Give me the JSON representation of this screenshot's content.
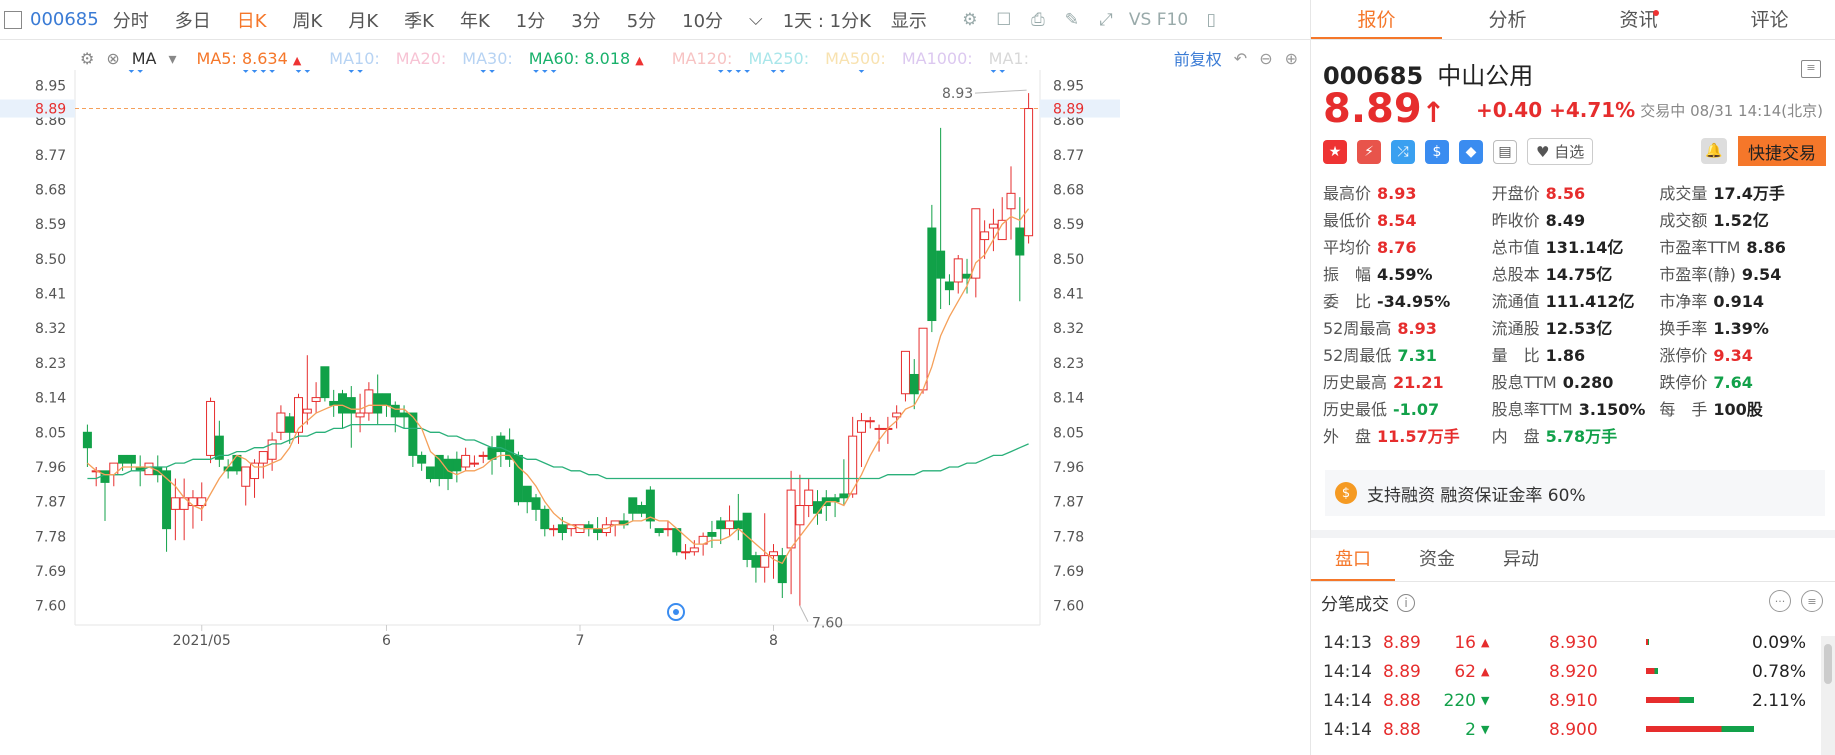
{
  "toolbar": {
    "code": "000685",
    "periods": [
      "分时",
      "多日",
      "日K",
      "周K",
      "月K",
      "季K",
      "年K",
      "1分",
      "3分",
      "5分",
      "10分"
    ],
    "active_period": "日K",
    "interval_select": "1天 : 1分K",
    "display_label": "显示",
    "vs_label": "VS F10"
  },
  "ma_bar": {
    "selector": "MA",
    "items": [
      {
        "label": "MA5:",
        "value": "8.634",
        "arrow": "▲",
        "color": "#f5772a"
      },
      {
        "label": "MA10:",
        "value": "",
        "color": "#b7d3f3"
      },
      {
        "label": "MA20:",
        "value": "",
        "color": "#f7c3d4"
      },
      {
        "label": "MA30:",
        "value": "",
        "color": "#b7d3f3"
      },
      {
        "label": "MA60:",
        "value": "8.018",
        "arrow": "▲",
        "color": "#19b16b"
      },
      {
        "label": "MA120:",
        "value": "",
        "color": "#f7c3c3"
      },
      {
        "label": "MA250:",
        "value": "",
        "color": "#a9e6ea"
      },
      {
        "label": "MA500:",
        "value": "",
        "color": "#f8e2b0"
      },
      {
        "label": "MA1000:",
        "value": "",
        "color": "#dcc8f0"
      },
      {
        "label": "MA1:",
        "value": "",
        "color": "#d8d8d8"
      }
    ],
    "adjust_label": "前复权"
  },
  "chart_data": {
    "type": "candlestick",
    "y_ticks": [
      "8.95",
      "8.86",
      "8.77",
      "8.68",
      "8.59",
      "8.50",
      "8.41",
      "8.32",
      "8.23",
      "8.14",
      "8.05",
      "7.96",
      "7.87",
      "7.78",
      "7.69",
      "7.60"
    ],
    "ylim": [
      7.55,
      8.99
    ],
    "x_labels": [
      "2021/05",
      "6",
      "7",
      "8"
    ],
    "x_label_positions": [
      13,
      34,
      56,
      78
    ],
    "current_price_line": "8.89",
    "annotation_high": "8.93",
    "annotation_low": "7.60",
    "candles": [
      [
        8.05,
        8.01,
        8.07,
        7.96
      ],
      [
        7.95,
        7.95,
        7.96,
        7.91
      ],
      [
        7.95,
        7.92,
        7.92,
        7.82
      ],
      [
        7.94,
        7.97,
        7.97,
        7.91
      ],
      [
        7.99,
        7.97,
        7.99,
        7.95
      ],
      [
        7.99,
        7.97,
        7.99,
        7.95
      ],
      [
        7.96,
        7.95,
        7.99,
        7.91
      ],
      [
        7.94,
        7.97,
        7.97,
        7.94
      ],
      [
        7.96,
        7.94,
        7.99,
        7.92
      ],
      [
        7.95,
        7.8,
        7.96,
        7.74
      ],
      [
        7.85,
        7.88,
        7.93,
        7.77
      ],
      [
        7.85,
        7.88,
        7.93,
        7.77
      ],
      [
        7.86,
        7.88,
        7.9,
        7.8
      ],
      [
        7.86,
        7.88,
        7.92,
        7.82
      ],
      [
        7.99,
        8.13,
        8.14,
        7.97
      ],
      [
        8.04,
        7.98,
        8.08,
        7.96
      ],
      [
        7.96,
        7.95,
        7.98,
        7.93
      ],
      [
        7.99,
        7.95,
        7.98,
        7.94
      ],
      [
        7.91,
        7.96,
        7.96,
        7.86
      ],
      [
        7.93,
        7.97,
        7.98,
        7.88
      ],
      [
        7.97,
        8.0,
        8.0,
        7.93
      ],
      [
        7.98,
        8.03,
        8.05,
        7.95
      ],
      [
        8.05,
        8.1,
        8.12,
        8.03
      ],
      [
        8.09,
        8.05,
        8.1,
        8.02
      ],
      [
        8.05,
        8.14,
        8.15,
        8.02
      ],
      [
        8.1,
        8.11,
        8.25,
        8.07
      ],
      [
        8.13,
        8.14,
        8.18,
        8.1
      ],
      [
        8.22,
        8.14,
        8.22,
        8.13
      ],
      [
        8.13,
        8.12,
        8.16,
        8.09
      ],
      [
        8.15,
        8.1,
        8.16,
        8.06
      ],
      [
        8.14,
        8.1,
        8.17,
        8.01
      ],
      [
        8.09,
        8.1,
        8.15,
        8.05
      ],
      [
        8.1,
        8.16,
        8.18,
        8.08
      ],
      [
        8.15,
        8.1,
        8.2,
        8.07
      ],
      [
        8.15,
        8.12,
        8.15,
        8.09
      ],
      [
        8.12,
        8.09,
        8.13,
        8.05
      ],
      [
        8.1,
        8.09,
        8.12,
        8.06
      ],
      [
        8.1,
        7.99,
        8.1,
        7.96
      ],
      [
        7.99,
        7.97,
        8.0,
        7.95
      ],
      [
        7.96,
        7.93,
        7.96,
        7.92
      ],
      [
        7.99,
        7.93,
        7.98,
        7.91
      ],
      [
        7.98,
        7.93,
        7.99,
        7.9
      ],
      [
        7.98,
        7.95,
        8.0,
        7.92
      ],
      [
        7.96,
        7.99,
        8.01,
        7.95
      ],
      [
        7.97,
        7.97,
        7.99,
        7.96
      ],
      [
        7.99,
        7.99,
        8.0,
        7.97
      ],
      [
        8.01,
        7.98,
        8.04,
        7.94
      ],
      [
        8.04,
        8.0,
        8.05,
        7.96
      ],
      [
        8.03,
        7.98,
        8.06,
        7.96
      ],
      [
        7.99,
        7.87,
        8.0,
        7.86
      ],
      [
        7.91,
        7.87,
        7.91,
        7.84
      ],
      [
        7.88,
        7.85,
        7.89,
        7.82
      ],
      [
        7.85,
        7.8,
        7.86,
        7.78
      ],
      [
        7.8,
        7.8,
        7.81,
        7.78
      ],
      [
        7.81,
        7.79,
        7.83,
        7.77
      ],
      [
        7.8,
        7.81,
        7.81,
        7.78
      ],
      [
        7.79,
        7.81,
        7.81,
        7.79
      ],
      [
        7.81,
        7.8,
        7.82,
        7.78
      ],
      [
        7.8,
        7.79,
        7.83,
        7.77
      ],
      [
        7.79,
        7.81,
        7.83,
        7.78
      ],
      [
        7.81,
        7.82,
        7.82,
        7.78
      ],
      [
        7.82,
        7.81,
        7.84,
        7.8
      ],
      [
        7.88,
        7.84,
        7.88,
        7.82
      ],
      [
        7.86,
        7.84,
        7.87,
        7.83
      ],
      [
        7.9,
        7.82,
        7.91,
        7.8
      ],
      [
        7.8,
        7.79,
        7.8,
        7.78
      ],
      [
        7.8,
        7.8,
        7.82,
        7.78
      ],
      [
        7.8,
        7.74,
        7.8,
        7.73
      ],
      [
        7.74,
        7.74,
        7.76,
        7.72
      ],
      [
        7.74,
        7.75,
        7.77,
        7.73
      ],
      [
        7.76,
        7.78,
        7.79,
        7.73
      ],
      [
        7.79,
        7.78,
        7.82,
        7.75
      ],
      [
        7.82,
        7.8,
        7.83,
        7.76
      ],
      [
        7.8,
        7.82,
        7.86,
        7.78
      ],
      [
        7.82,
        7.8,
        7.89,
        7.77
      ],
      [
        7.84,
        7.72,
        7.84,
        7.7
      ],
      [
        7.73,
        7.7,
        7.74,
        7.66
      ],
      [
        7.7,
        7.73,
        7.84,
        7.66
      ],
      [
        7.73,
        7.74,
        7.76,
        7.67
      ],
      [
        7.73,
        7.66,
        7.75,
        7.62
      ],
      [
        7.75,
        7.9,
        7.95,
        7.63
      ],
      [
        7.81,
        7.86,
        7.94,
        7.6
      ],
      [
        7.86,
        7.9,
        7.93,
        7.83
      ],
      [
        7.87,
        7.84,
        7.9,
        7.81
      ],
      [
        7.88,
        7.86,
        7.9,
        7.82
      ],
      [
        7.88,
        7.87,
        7.89,
        7.83
      ],
      [
        7.89,
        7.88,
        7.98,
        7.86
      ],
      [
        7.89,
        8.04,
        8.09,
        7.88
      ],
      [
        8.05,
        8.08,
        8.1,
        7.96
      ],
      [
        8.08,
        8.08,
        8.09,
        8.06
      ],
      [
        8.06,
        8.06,
        8.07,
        8.0
      ],
      [
        8.06,
        8.06,
        8.09,
        8.02
      ],
      [
        8.09,
        8.1,
        8.12,
        8.06
      ],
      [
        8.15,
        8.26,
        8.26,
        8.13
      ],
      [
        8.2,
        8.15,
        8.24,
        8.11
      ],
      [
        8.16,
        8.32,
        8.32,
        8.15
      ],
      [
        8.58,
        8.34,
        8.64,
        8.31
      ],
      [
        8.52,
        8.45,
        8.84,
        8.37
      ],
      [
        8.44,
        8.42,
        8.46,
        8.38
      ],
      [
        8.44,
        8.5,
        8.51,
        8.41
      ],
      [
        8.46,
        8.45,
        8.5,
        8.41
      ],
      [
        8.45,
        8.63,
        8.63,
        8.4
      ],
      [
        8.55,
        8.57,
        8.6,
        8.5
      ],
      [
        8.58,
        8.59,
        8.63,
        8.52
      ],
      [
        8.55,
        8.6,
        8.66,
        8.55
      ],
      [
        8.63,
        8.67,
        8.74,
        8.55
      ],
      [
        8.58,
        8.51,
        8.66,
        8.39
      ],
      [
        8.56,
        8.89,
        8.93,
        8.54
      ]
    ],
    "ma5": [
      7.97,
      7.95,
      7.94,
      7.94,
      7.96,
      7.96,
      7.96,
      7.96,
      7.95,
      7.93,
      7.91,
      7.88,
      7.86,
      7.85,
      7.89,
      7.93,
      7.96,
      7.99,
      7.98,
      7.96,
      7.96,
      7.97,
      7.98,
      8.01,
      8.06,
      8.08,
      8.1,
      8.11,
      8.12,
      8.12,
      8.11,
      8.11,
      8.12,
      8.12,
      8.12,
      8.11,
      8.11,
      8.09,
      8.06,
      8.0,
      7.98,
      7.95,
      7.94,
      7.95,
      7.95,
      7.96,
      7.98,
      7.99,
      7.99,
      7.96,
      7.94,
      7.91,
      7.87,
      7.84,
      7.82,
      7.81,
      7.8,
      7.8,
      7.8,
      7.8,
      7.81,
      7.81,
      7.82,
      7.82,
      7.83,
      7.82,
      7.82,
      7.8,
      7.78,
      7.76,
      7.76,
      7.77,
      7.77,
      7.78,
      7.8,
      7.78,
      7.76,
      7.74,
      7.72,
      7.71,
      7.75,
      7.78,
      7.81,
      7.84,
      7.87,
      7.87,
      7.86,
      7.9,
      7.94,
      7.99,
      8.03,
      8.06,
      8.08,
      8.11,
      8.12,
      8.16,
      8.22,
      8.3,
      8.35,
      8.39,
      8.43,
      8.49,
      8.51,
      8.55,
      8.59,
      8.61,
      8.6,
      8.63
    ],
    "ma60": [
      7.93,
      7.93,
      7.94,
      7.94,
      7.94,
      7.95,
      7.95,
      7.96,
      7.96,
      7.96,
      7.97,
      7.97,
      7.98,
      7.98,
      7.98,
      7.99,
      7.99,
      8.0,
      8.0,
      8.01,
      8.01,
      8.02,
      8.02,
      8.03,
      8.04,
      8.04,
      8.05,
      8.05,
      8.06,
      8.06,
      8.07,
      8.07,
      8.07,
      8.07,
      8.07,
      8.07,
      8.06,
      8.06,
      8.06,
      8.05,
      8.05,
      8.04,
      8.04,
      8.03,
      8.03,
      8.02,
      8.01,
      8.01,
      8.0,
      7.99,
      7.98,
      7.98,
      7.97,
      7.96,
      7.96,
      7.95,
      7.95,
      7.94,
      7.94,
      7.93,
      7.93,
      7.93,
      7.93,
      7.93,
      7.93,
      7.93,
      7.93,
      7.93,
      7.93,
      7.93,
      7.93,
      7.93,
      7.93,
      7.93,
      7.93,
      7.93,
      7.93,
      7.93,
      7.93,
      7.93,
      7.93,
      7.93,
      7.93,
      7.93,
      7.93,
      7.93,
      7.93,
      7.93,
      7.93,
      7.93,
      7.93,
      7.94,
      7.94,
      7.94,
      7.94,
      7.95,
      7.95,
      7.95,
      7.96,
      7.96,
      7.97,
      7.97,
      7.98,
      7.99,
      7.99,
      8.0,
      8.01,
      8.02
    ]
  },
  "quote": {
    "code": "000685",
    "name": "中山公用",
    "price": "8.89",
    "arrow": "↑",
    "change": "+0.40",
    "change_pct": "+4.71%",
    "status": "交易中 08/31 14:14(北京)",
    "watch_label": "自选",
    "quick_trade": "快捷交易",
    "stats": [
      [
        [
          "最高价",
          "8.93",
          "red"
        ],
        [
          "开盘价",
          "8.56",
          "red"
        ],
        [
          "成交量",
          "17.4万手",
          "blk"
        ]
      ],
      [
        [
          "最低价",
          "8.54",
          "red"
        ],
        [
          "昨收价",
          "8.49",
          "blk"
        ],
        [
          "成交额",
          "1.52亿",
          "blk"
        ]
      ],
      [
        [
          "平均价",
          "8.76",
          "red"
        ],
        [
          "总市值",
          "131.14亿",
          "blk"
        ],
        [
          "市盈率TTM",
          "8.86",
          "blk"
        ]
      ],
      [
        [
          "振　幅",
          "4.59%",
          "blk"
        ],
        [
          "总股本",
          "14.75亿",
          "blk"
        ],
        [
          "市盈率(静)",
          "9.54",
          "blk"
        ]
      ],
      [
        [
          "委　比",
          "-34.95%",
          "blk"
        ],
        [
          "流通值",
          "111.412亿",
          "blk"
        ],
        [
          "市净率",
          "0.914",
          "blk"
        ]
      ],
      [
        [
          "52周最高",
          "8.93",
          "red"
        ],
        [
          "流通股",
          "12.53亿",
          "blk"
        ],
        [
          "换手率",
          "1.39%",
          "blk"
        ]
      ],
      [
        [
          "52周最低",
          "7.31",
          "grn"
        ],
        [
          "量　比",
          "1.86",
          "blk"
        ],
        [
          "涨停价",
          "9.34",
          "red"
        ]
      ],
      [
        [
          "历史最高",
          "21.21",
          "red"
        ],
        [
          "股息TTM",
          "0.280",
          "blk"
        ],
        [
          "跌停价",
          "7.64",
          "grn"
        ]
      ],
      [
        [
          "历史最低",
          "-1.07",
          "grn"
        ],
        [
          "股息率TTM",
          "3.150%",
          "blk"
        ],
        [
          "每　手",
          "100股",
          "blk"
        ]
      ],
      [
        [
          "外　盘",
          "11.57万手",
          "red"
        ],
        [
          "内　盘",
          "5.78万手",
          "grn"
        ],
        [
          "",
          "",
          " "
        ]
      ]
    ],
    "margin_text": "支持融资 融资保证金率 60%"
  },
  "right_tabs": [
    "报价",
    "分析",
    "资讯",
    "评论"
  ],
  "sub_tabs": [
    "盘口",
    "资金",
    "异动"
  ],
  "fenbi": {
    "title": "分笔成交",
    "rows": [
      {
        "time": "14:13",
        "price": "8.89",
        "vol": "16",
        "dir": "up",
        "level": "8.930",
        "pct": "0.09%",
        "bar": 0.02
      },
      {
        "time": "14:14",
        "price": "8.89",
        "vol": "62",
        "dir": "up",
        "level": "8.920",
        "pct": "0.78%",
        "bar": 0.1
      },
      {
        "time": "14:14",
        "price": "8.88",
        "vol": "220",
        "dir": "down",
        "level": "8.910",
        "pct": "2.11%",
        "bar": 0.4
      },
      {
        "time": "14:14",
        "price": "8.88",
        "vol": "2",
        "dir": "down",
        "level": "8.900",
        "pct": "",
        "bar": 0.9
      }
    ]
  }
}
